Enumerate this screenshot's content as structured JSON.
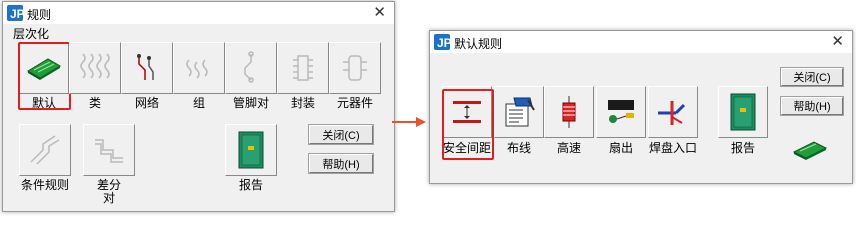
{
  "left_dialog": {
    "title": "规则",
    "group_label": "层次化",
    "tools_row1": [
      {
        "label": "默认",
        "icon": "pcb-board-icon"
      },
      {
        "label": "类",
        "icon": "net-class-icon"
      },
      {
        "label": "网络",
        "icon": "net-icon"
      },
      {
        "label": "组",
        "icon": "group-icon"
      },
      {
        "label": "管脚对",
        "icon": "pin-pair-icon"
      },
      {
        "label": "封装",
        "icon": "footprint-icon"
      },
      {
        "label": "元器件",
        "icon": "component-icon"
      }
    ],
    "tools_row2": [
      {
        "label": "条件规则",
        "icon": "conditional-rule-icon"
      },
      {
        "label": "差分\n对",
        "icon": "diff-pair-icon"
      },
      {
        "label": "报告",
        "icon": "report-icon"
      }
    ],
    "close_button": "关闭(C)",
    "help_button": "帮助(H)"
  },
  "right_dialog": {
    "title": "默认规则",
    "tools": [
      {
        "label": "安全间距",
        "icon": "clearance-icon"
      },
      {
        "label": "布线",
        "icon": "routing-icon"
      },
      {
        "label": "高速",
        "icon": "high-speed-icon"
      },
      {
        "label": "扇出",
        "icon": "fanout-icon"
      },
      {
        "label": "焊盘入口",
        "icon": "pad-entry-icon"
      },
      {
        "label": "报告",
        "icon": "report-icon"
      }
    ],
    "close_button": "关闭(C)",
    "help_button": "帮助(H)"
  },
  "colors": {
    "highlight": "#e02020",
    "arrow": "#e8522a",
    "board_green": "#1f9e3a"
  }
}
